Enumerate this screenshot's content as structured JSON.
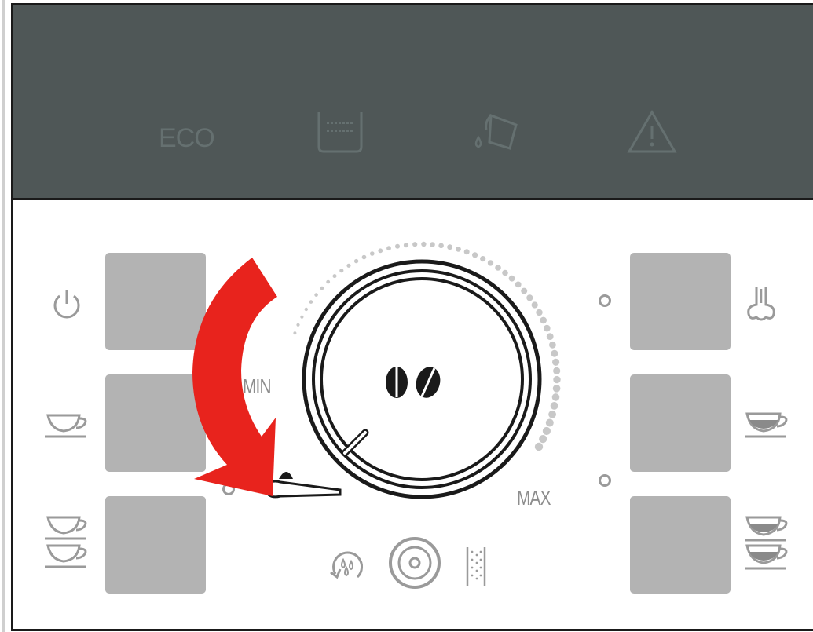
{
  "display": {
    "eco_label": "ECO",
    "icons": [
      "water-tank-icon",
      "grounds-container-icon",
      "warning-icon"
    ]
  },
  "dial": {
    "min_label": "MIN",
    "max_label": "MAX",
    "center_icon": "coffee-beans-icon"
  },
  "left_buttons": [
    {
      "icon": "power-icon"
    },
    {
      "icon": "single-cup-icon"
    },
    {
      "icon": "double-cup-icon"
    }
  ],
  "right_buttons": [
    {
      "icon": "steam-icon"
    },
    {
      "icon": "single-cup-strong-icon"
    },
    {
      "icon": "double-cup-strong-icon"
    }
  ],
  "bottom_icons": [
    "rinse-icon",
    "selector-knob-icon",
    "hot-water-icon"
  ],
  "colors": {
    "display_bg": "#4f5757",
    "button_gray": "#b3b3b3",
    "arrow_red": "#e8231d",
    "icon_gray": "#9a9a9a"
  }
}
